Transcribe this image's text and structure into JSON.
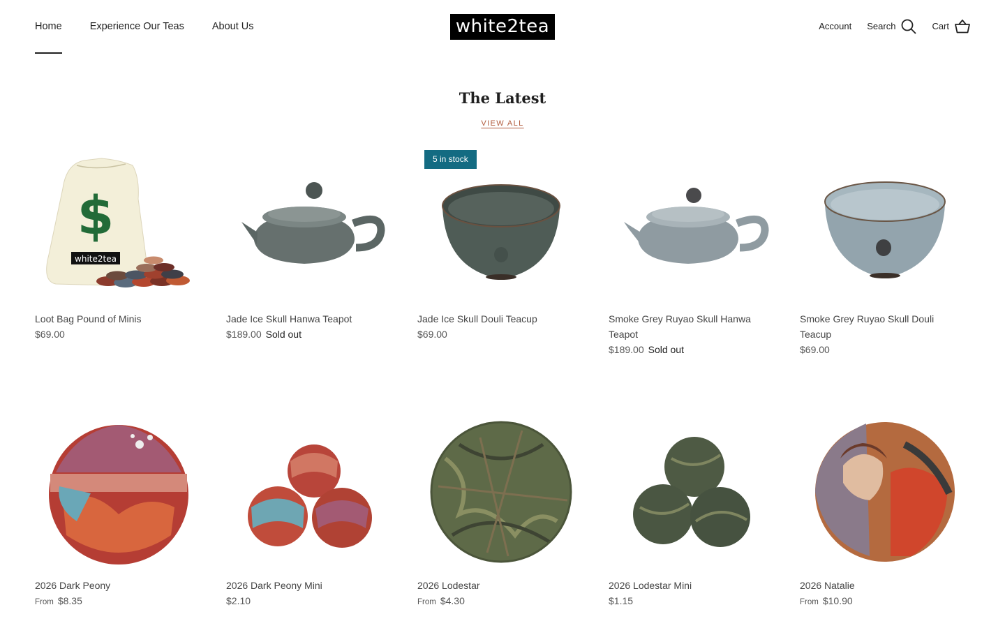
{
  "header": {
    "nav": [
      "Home",
      "Experience Our Teas",
      "About Us"
    ],
    "logo": "white2tea",
    "account": "Account",
    "search": "Search",
    "cart": "Cart"
  },
  "section": {
    "title": "The Latest",
    "view_all": "VIEW ALL"
  },
  "products": [
    {
      "name": "Loot Bag Pound of Minis",
      "price": "$69.00",
      "from": "",
      "status": "",
      "badge": "",
      "bag_label": "white2tea",
      "bag_symbol": "$",
      "image": "loot-bag"
    },
    {
      "name": "Jade Ice Skull Hanwa Teapot",
      "price": "$189.00",
      "from": "",
      "status": "Sold out",
      "badge": "",
      "image": "teapot-jade"
    },
    {
      "name": "Jade Ice Skull Douli Teacup",
      "price": "$69.00",
      "from": "",
      "status": "",
      "badge": "5 in stock",
      "image": "cup-jade"
    },
    {
      "name": "Smoke Grey Ruyao Skull Hanwa Teapot",
      "name_line1": "Smoke Grey Ruyao Skull Hanwa",
      "name_line2": "Teapot",
      "price": "$189.00",
      "from": "",
      "status": "Sold out",
      "badge": "",
      "image": "teapot-grey"
    },
    {
      "name": "Smoke Grey Ruyao Skull Douli Teacup",
      "price": "$69.00",
      "from": "",
      "status": "",
      "badge": "",
      "image": "cup-grey"
    },
    {
      "name": "2026 Dark Peony",
      "price": "$8.35",
      "from": "From",
      "status": "",
      "badge": "",
      "image": "cake-peony"
    },
    {
      "name": "2026 Dark Peony Mini",
      "price": "$2.10",
      "from": "",
      "status": "",
      "badge": "",
      "image": "minis-peony"
    },
    {
      "name": "2026 Lodestar",
      "price": "$4.30",
      "from": "From",
      "status": "",
      "badge": "",
      "image": "cake-lodestar"
    },
    {
      "name": "2026 Lodestar Mini",
      "price": "$1.15",
      "from": "",
      "status": "",
      "badge": "",
      "image": "minis-lodestar"
    },
    {
      "name": "2026 Natalie",
      "price": "$10.90",
      "from": "From",
      "status": "",
      "badge": "",
      "image": "cake-natalie"
    }
  ],
  "colors": {
    "badge": "#136b82",
    "view_all": "#b05a3c",
    "logo_bg": "#000000"
  }
}
